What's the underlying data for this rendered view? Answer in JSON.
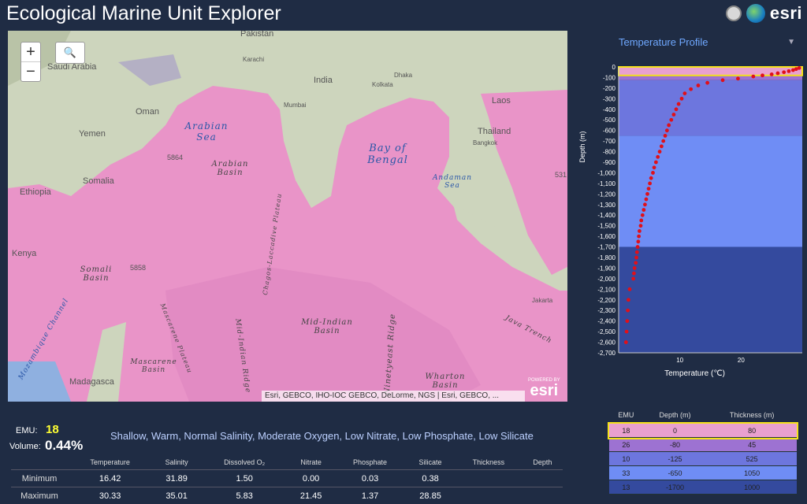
{
  "header": {
    "title": "Ecological Marine Unit Explorer",
    "brand": "esri"
  },
  "map": {
    "zoom_in": "+",
    "zoom_out": "−",
    "search_glyph": "🔍",
    "land_labels": [
      "Pakistan",
      "Saudi Arabia",
      "Oman",
      "Yemen",
      "Ethiopia",
      "Somalia",
      "Kenya",
      "India",
      "Laos",
      "Thailand",
      "Madagasca"
    ],
    "city_labels": [
      "Karachi",
      "Mumbai",
      "Dhaka",
      "Kolkata",
      "Bangkok",
      "Jakarta"
    ],
    "sea_labels": [
      "Arabian Sea",
      "Bay of Bengal",
      "Andaman Sea",
      "Mozambique Channel"
    ],
    "feature_labels": [
      "Arabian Basin",
      "Somali Basin",
      "Mid-Indian Basin",
      "Mascarene Basin",
      "Wharton Basin",
      "Mascarene Plateau",
      "Chagos-Laccadive Plateau",
      "Mid-Indian Ridge",
      "Ninetyeast Ridge",
      "Java Trench"
    ],
    "depth_labels": [
      "5864",
      "5858",
      "531"
    ],
    "attribution": "Esri, GEBCO, IHO-IOC GEBCO, DeLorme, NGS | Esri, GEBCO, ...",
    "powered_by": "POWERED BY",
    "powered_brand": "esri",
    "unit_color": "#e994c8"
  },
  "profile": {
    "selector": "Temperature Profile",
    "chart_data": {
      "type": "scatter",
      "xlabel": "Temperature (℃)",
      "ylabel": "Depth (m)",
      "xlim": [
        0,
        30
      ],
      "ylim": [
        -2700,
        0
      ],
      "x_ticks": [
        10,
        20
      ],
      "y_ticks": [
        0,
        -100,
        -200,
        -300,
        -400,
        -500,
        -600,
        -700,
        -800,
        -900,
        -1000,
        -1100,
        -1200,
        -1300,
        -1400,
        -1500,
        -1600,
        -1700,
        -1800,
        -1900,
        -2000,
        -2100,
        -2200,
        -2300,
        -2400,
        -2500,
        -2600,
        -2700
      ],
      "bands": [
        {
          "top": 0,
          "bottom": -80,
          "color": "#e9a0cf"
        },
        {
          "top": -80,
          "bottom": -125,
          "color": "#9d72d2"
        },
        {
          "top": -125,
          "bottom": -650,
          "color": "#6d76de"
        },
        {
          "top": -650,
          "bottom": -1700,
          "color": "#6f8df5"
        },
        {
          "top": -1700,
          "bottom": -2700,
          "color": "#344a9e"
        }
      ],
      "points": [
        [
          29.5,
          -10
        ],
        [
          29,
          -20
        ],
        [
          28.5,
          -30
        ],
        [
          27.8,
          -40
        ],
        [
          27,
          -50
        ],
        [
          26,
          -60
        ],
        [
          25,
          -70
        ],
        [
          23.5,
          -80
        ],
        [
          22,
          -90
        ],
        [
          19.5,
          -110
        ],
        [
          17,
          -125
        ],
        [
          14.5,
          -150
        ],
        [
          13,
          -175
        ],
        [
          11.8,
          -210
        ],
        [
          10.8,
          -250
        ],
        [
          10.3,
          -300
        ],
        [
          9.8,
          -350
        ],
        [
          9.4,
          -400
        ],
        [
          9,
          -450
        ],
        [
          8.6,
          -500
        ],
        [
          8.2,
          -550
        ],
        [
          7.9,
          -600
        ],
        [
          7.6,
          -650
        ],
        [
          7.3,
          -700
        ],
        [
          7,
          -750
        ],
        [
          6.7,
          -800
        ],
        [
          6.4,
          -850
        ],
        [
          6.1,
          -900
        ],
        [
          5.8,
          -950
        ],
        [
          5.6,
          -1000
        ],
        [
          5.3,
          -1050
        ],
        [
          5.1,
          -1100
        ],
        [
          4.9,
          -1150
        ],
        [
          4.7,
          -1200
        ],
        [
          4.5,
          -1250
        ],
        [
          4.3,
          -1300
        ],
        [
          4.1,
          -1350
        ],
        [
          3.9,
          -1400
        ],
        [
          3.7,
          -1450
        ],
        [
          3.6,
          -1500
        ],
        [
          3.4,
          -1550
        ],
        [
          3.3,
          -1600
        ],
        [
          3.2,
          -1650
        ],
        [
          3.1,
          -1700
        ],
        [
          3,
          -1750
        ],
        [
          2.9,
          -1800
        ],
        [
          2.8,
          -1850
        ],
        [
          2.6,
          -1900
        ],
        [
          2.5,
          -1950
        ],
        [
          2.4,
          -2000
        ],
        [
          1.8,
          -2100
        ],
        [
          1.6,
          -2200
        ],
        [
          1.5,
          -2300
        ],
        [
          1.4,
          -2400
        ],
        [
          1.3,
          -2500
        ],
        [
          1.2,
          -2600
        ]
      ]
    }
  },
  "summary": {
    "emu_label": "EMU:",
    "emu_value": "18",
    "volume_label": "Volume:",
    "volume_value": "0.44%",
    "description": "Shallow, Warm, Normal Salinity, Moderate Oxygen, Low Nitrate, Low Phosphate, Low Silicate"
  },
  "stats": {
    "columns": [
      "Temperature",
      "Salinity",
      "Dissolved O₂",
      "Nitrate",
      "Phosphate",
      "Silicate",
      "Thickness",
      "Depth"
    ],
    "rows": [
      {
        "label": "Minimum",
        "values": [
          "16.42",
          "31.89",
          "1.50",
          "0.00",
          "0.03",
          "0.38",
          "",
          ""
        ]
      },
      {
        "label": "Maximum",
        "values": [
          "30.33",
          "35.01",
          "5.83",
          "21.45",
          "1.37",
          "28.85",
          "",
          ""
        ]
      }
    ]
  },
  "emu_table": {
    "columns": [
      "EMU",
      "Depth (m)",
      "Thickness (m)"
    ],
    "rows": [
      {
        "emu": "18",
        "depth": "0",
        "thickness": "80",
        "color": "#e9a0cf",
        "selected": true
      },
      {
        "emu": "26",
        "depth": "-80",
        "thickness": "45",
        "color": "#9d72d2",
        "selected": false
      },
      {
        "emu": "10",
        "depth": "-125",
        "thickness": "525",
        "color": "#6d76de",
        "selected": false
      },
      {
        "emu": "33",
        "depth": "-650",
        "thickness": "1050",
        "color": "#6f8df5",
        "selected": false
      },
      {
        "emu": "13",
        "depth": "-1700",
        "thickness": "1000",
        "color": "#344a9e",
        "selected": false
      }
    ]
  }
}
